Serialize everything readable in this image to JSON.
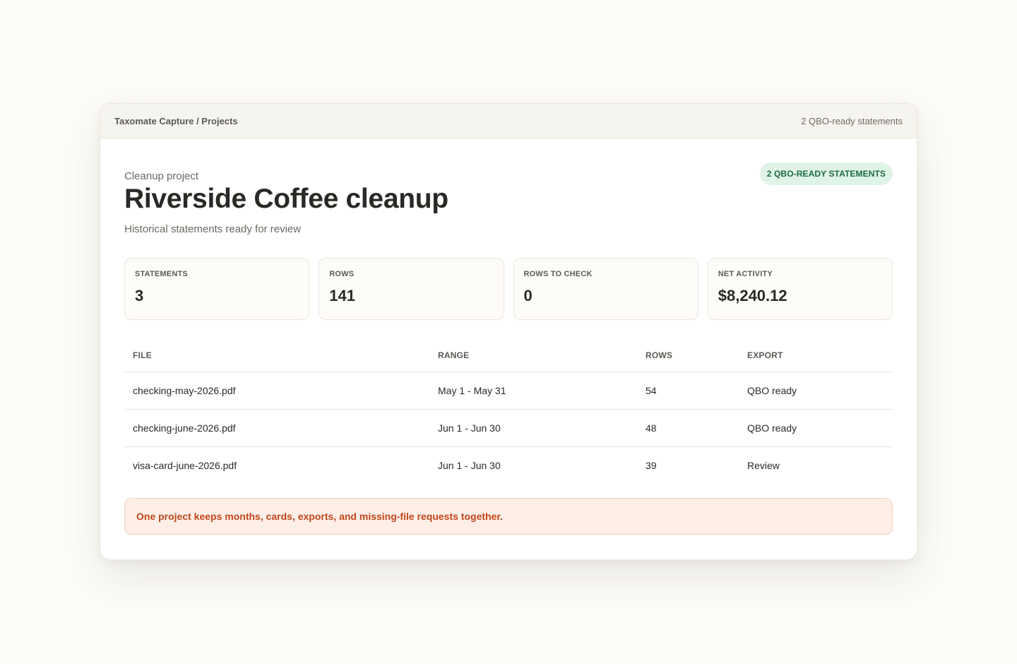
{
  "window": {
    "breadcrumb": "Taxomate Capture / Projects",
    "status": "2 QBO-ready statements"
  },
  "project": {
    "eyebrow": "Cleanup project",
    "title": "Riverside Coffee cleanup",
    "subtitle": "Historical statements ready for review",
    "badge": "2 QBO-READY STATEMENTS"
  },
  "stats": [
    {
      "label": "STATEMENTS",
      "value": "3"
    },
    {
      "label": "ROWS",
      "value": "141"
    },
    {
      "label": "ROWS TO CHECK",
      "value": "0"
    },
    {
      "label": "NET ACTIVITY",
      "value": "$8,240.12"
    }
  ],
  "table": {
    "headers": [
      "FILE",
      "RANGE",
      "ROWS",
      "EXPORT"
    ],
    "rows": [
      {
        "file": "checking-may-2026.pdf",
        "range": "May 1 - May 31",
        "rows": "54",
        "export": "QBO ready"
      },
      {
        "file": "checking-june-2026.pdf",
        "range": "Jun 1 - Jun 30",
        "rows": "48",
        "export": "QBO ready"
      },
      {
        "file": "visa-card-june-2026.pdf",
        "range": "Jun 1 - Jun 30",
        "rows": "39",
        "export": "Review"
      }
    ]
  },
  "callout": "One project keeps months, cards, exports, and missing-file requests together.",
  "colors": {
    "accent_green_bg": "#dff3e7",
    "accent_green_text": "#1d6a44",
    "callout_bg": "#fdefe8",
    "callout_text": "#c2461b"
  }
}
